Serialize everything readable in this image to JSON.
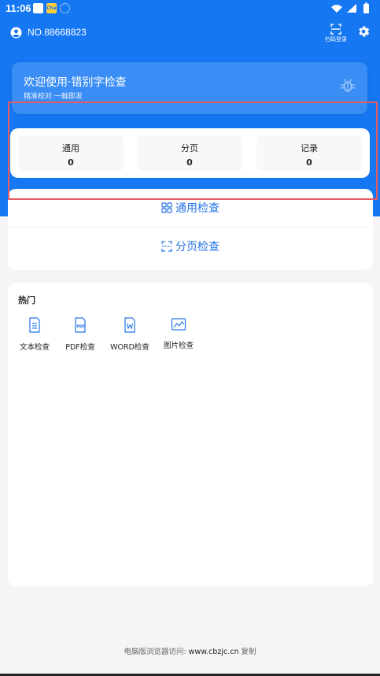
{
  "status_bar": {
    "time": "11:06",
    "app_badge": "Chat"
  },
  "header": {
    "account_no": "NO.88668823",
    "scan_label": "扫码登录"
  },
  "welcome": {
    "title": "欢迎使用·错别字检查",
    "subtitle": "精准校对 一触即发"
  },
  "stats": [
    {
      "label": "通用",
      "value": "0"
    },
    {
      "label": "分页",
      "value": "0"
    },
    {
      "label": "记录",
      "value": "0"
    }
  ],
  "checks": {
    "general": "通用检查",
    "paged": "分页检查"
  },
  "hot": {
    "heading": "热门",
    "tools": [
      {
        "label": "文本检查",
        "icon": "text-doc-icon"
      },
      {
        "label": "PDF检查",
        "icon": "pdf-doc-icon"
      },
      {
        "label": "WORD检查",
        "icon": "word-doc-icon"
      },
      {
        "label": "图片检查",
        "icon": "image-doc-icon"
      }
    ]
  },
  "footer": {
    "prefix": "电脑版浏览器访问:",
    "url": "www.cbzjc.cn",
    "copy": "复制"
  },
  "colors": {
    "primary": "#1677f2",
    "accent_text": "#2474e8",
    "highlight": "#e85a62"
  }
}
